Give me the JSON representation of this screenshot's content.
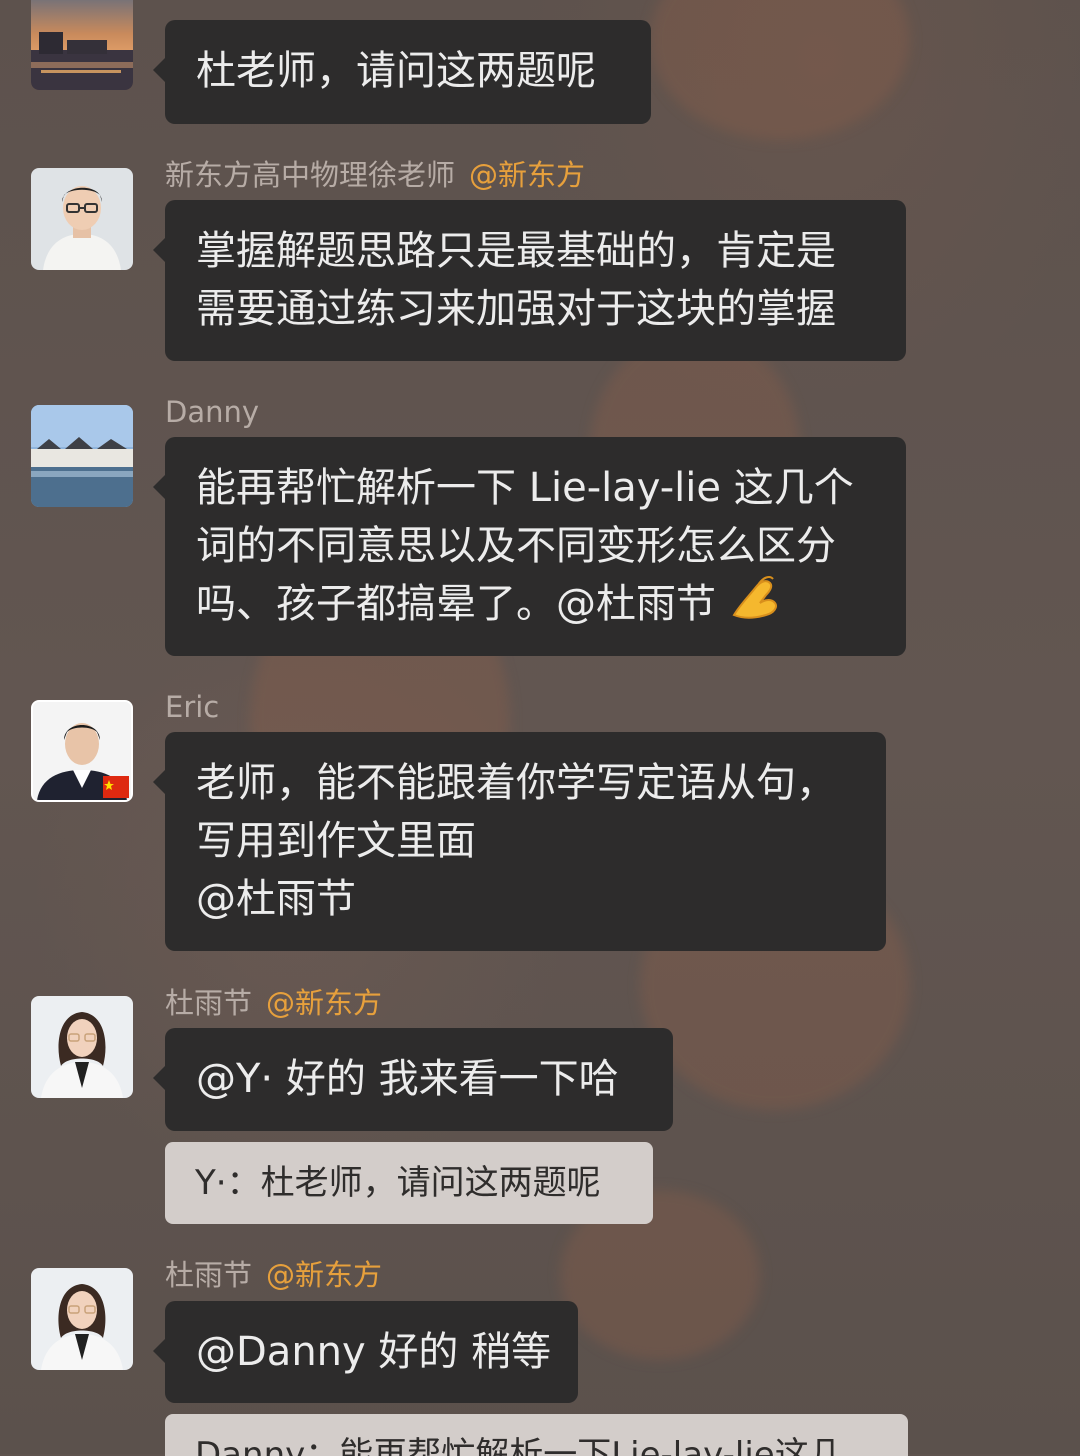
{
  "messages": [
    {
      "sender": "",
      "lines": [
        "杜老师，请问这两题呢"
      ]
    },
    {
      "sender": "新东方高中物理徐老师",
      "org": "@新东方",
      "lines": [
        "掌握解题思路只是最基础的，肯定是",
        "需要通过练习来加强对于这块的掌握"
      ]
    },
    {
      "sender": "Danny",
      "lines": [
        "能再帮忙解析一下 Lie-lay-lie 这几个",
        "词的不同意思以及不同变形怎么区分",
        "吗、孩子都搞晕了。@杜雨节"
      ],
      "emoji": "pinching-hand-emoji"
    },
    {
      "sender": "Eric",
      "lines": [
        "老师，能不能跟着你学写定语从句，",
        "写用到作文里面",
        "@杜雨节"
      ]
    },
    {
      "sender": "杜雨节",
      "org": "@新东方",
      "lines": [
        "@Y· 好的 我来看一下哈"
      ],
      "quote": "Y·：杜老师，请问这两题呢"
    },
    {
      "sender": "杜雨节",
      "org": "@新东方",
      "lines": [
        "@Danny 好的 稍等"
      ],
      "quote": "Danny：能再帮忙解析一下Lie-lay-lie这几"
    }
  ],
  "colors": {
    "background": "#5e534e",
    "bubble": "#2d2c2c",
    "bubble_text": "#ececec",
    "sender_text": "#b7aca6",
    "org_tag": "#e7a03c",
    "quote_bg": "#d3cdca",
    "quote_text": "#2f2d2c"
  }
}
